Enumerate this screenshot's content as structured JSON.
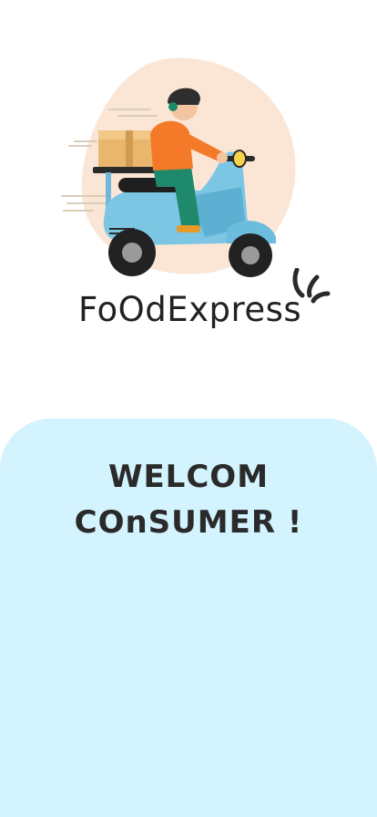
{
  "brand": {
    "name": "FoOdExpress"
  },
  "welcome": {
    "line1": "WELCOM",
    "line2": "COnSUMER !"
  },
  "colors": {
    "panel_background": "#d3f3fe",
    "illustration_blob": "#fbe6d6",
    "text_dark": "#222222"
  },
  "icons": {
    "hero": "delivery-scooter-illustration",
    "logo_accent": "sparkle-lines-icon"
  }
}
